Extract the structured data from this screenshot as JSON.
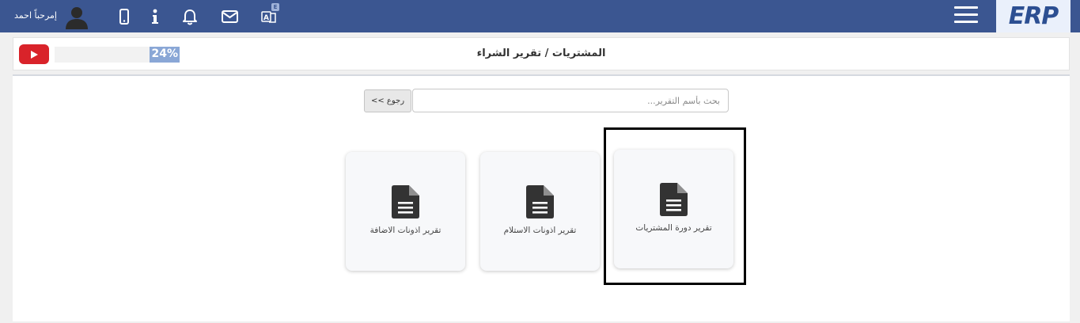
{
  "navbar": {
    "logo": "ERP",
    "user_greeting": "إمرحباً احمد",
    "lang_badge": "E",
    "colors": {
      "background": "#3b5691",
      "logo_bg": "#eaf0fb"
    },
    "icons": [
      "user-avatar-icon",
      "mobile-icon",
      "info-icon",
      "bell-icon",
      "mail-icon",
      "translate-icon",
      "hamburger-menu-icon"
    ]
  },
  "titlebar": {
    "title": "المشتريات / تقرير الشراء",
    "progress_text": "24%",
    "progress_value": 0.24,
    "video_icon": "youtube-play-icon"
  },
  "search": {
    "placeholder": "بحث بأسم التقرير...",
    "back_label": "<< رجوع"
  },
  "reports": [
    {
      "label": "تقرير دورة المشتريات",
      "icon": "document-icon"
    },
    {
      "label": "تقرير اذونات الاستلام",
      "icon": "document-icon"
    },
    {
      "label": "تقرير اذونات الاضافة",
      "icon": "document-icon"
    }
  ]
}
